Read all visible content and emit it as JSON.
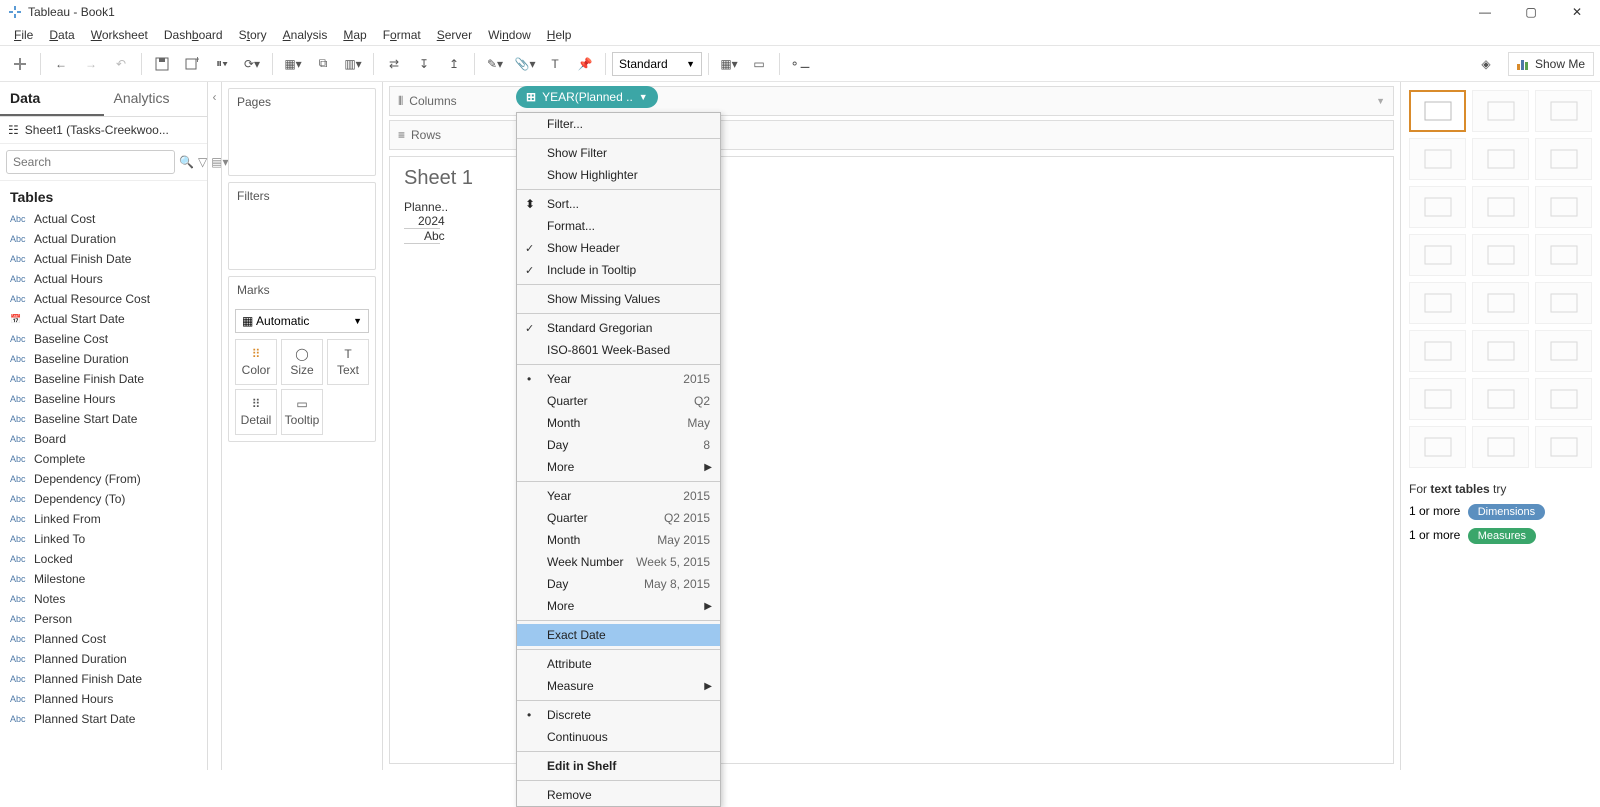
{
  "titlebar": {
    "app": "Tableau",
    "doc": "Book1"
  },
  "menus": [
    "File",
    "Data",
    "Worksheet",
    "Dashboard",
    "Story",
    "Analysis",
    "Map",
    "Format",
    "Server",
    "Window",
    "Help"
  ],
  "fit": "Standard",
  "showme_label": "Show Me",
  "data_pane": {
    "tabs": {
      "data": "Data",
      "analytics": "Analytics"
    },
    "datasource": "Sheet1 (Tasks-Creekwoo...",
    "search_placeholder": "Search",
    "tables_header": "Tables",
    "fields": [
      {
        "type": "Abc",
        "name": "Actual Cost"
      },
      {
        "type": "Abc",
        "name": "Actual Duration"
      },
      {
        "type": "Abc",
        "name": "Actual Finish Date"
      },
      {
        "type": "Abc",
        "name": "Actual Hours"
      },
      {
        "type": "Abc",
        "name": "Actual Resource Cost"
      },
      {
        "type": "date",
        "name": "Actual Start Date"
      },
      {
        "type": "Abc",
        "name": "Baseline Cost"
      },
      {
        "type": "Abc",
        "name": "Baseline Duration"
      },
      {
        "type": "Abc",
        "name": "Baseline Finish Date"
      },
      {
        "type": "Abc",
        "name": "Baseline Hours"
      },
      {
        "type": "Abc",
        "name": "Baseline Start Date"
      },
      {
        "type": "Abc",
        "name": "Board"
      },
      {
        "type": "Abc",
        "name": "Complete"
      },
      {
        "type": "Abc",
        "name": "Dependency (From)"
      },
      {
        "type": "Abc",
        "name": "Dependency (To)"
      },
      {
        "type": "Abc",
        "name": "Linked From"
      },
      {
        "type": "Abc",
        "name": "Linked To"
      },
      {
        "type": "Abc",
        "name": "Locked"
      },
      {
        "type": "Abc",
        "name": "Milestone"
      },
      {
        "type": "Abc",
        "name": "Notes"
      },
      {
        "type": "Abc",
        "name": "Person"
      },
      {
        "type": "Abc",
        "name": "Planned Cost"
      },
      {
        "type": "Abc",
        "name": "Planned Duration"
      },
      {
        "type": "Abc",
        "name": "Planned Finish Date"
      },
      {
        "type": "Abc",
        "name": "Planned Hours"
      },
      {
        "type": "Abc",
        "name": "Planned Start Date"
      }
    ]
  },
  "cards": {
    "pages": "Pages",
    "filters": "Filters",
    "marks": "Marks",
    "marks_type": "Automatic",
    "mark_cells": [
      "Color",
      "Size",
      "Text",
      "Detail",
      "Tooltip"
    ]
  },
  "shelves": {
    "columns": "Columns",
    "rows": "Rows",
    "pill": "YEAR(Planned .."
  },
  "viz": {
    "title": "Sheet 1",
    "field_hdr": "Planne..",
    "year": "2024",
    "mark": "Abc"
  },
  "context_menu": {
    "filter": "Filter...",
    "show_filter": "Show Filter",
    "show_highlighter": "Show Highlighter",
    "sort": "Sort...",
    "format": "Format...",
    "show_header": "Show Header",
    "include_tooltip": "Include in Tooltip",
    "show_missing": "Show Missing Values",
    "std_greg": "Standard Gregorian",
    "iso": "ISO-8601 Week-Based",
    "year": "Year",
    "year_ex": "2015",
    "quarter": "Quarter",
    "quarter_ex": "Q2",
    "month": "Month",
    "month_ex": "May",
    "day": "Day",
    "day_ex": "8",
    "more": "More",
    "year2": "Year",
    "year2_ex": "2015",
    "quarter2": "Quarter",
    "quarter2_ex": "Q2 2015",
    "month2": "Month",
    "month2_ex": "May 2015",
    "week_no": "Week Number",
    "week_no_ex": "Week 5, 2015",
    "day2": "Day",
    "day2_ex": "May 8, 2015",
    "more2": "More",
    "exact_date": "Exact Date",
    "attribute": "Attribute",
    "measure": "Measure",
    "discrete": "Discrete",
    "continuous": "Continuous",
    "edit_shelf": "Edit in Shelf",
    "remove": "Remove"
  },
  "showme": {
    "hint_prefix": "For ",
    "hint_bold": "text tables",
    "hint_suffix": " try",
    "line_dim": "1 or more ",
    "chip_dim": "Dimensions",
    "line_mea": "1 or more ",
    "chip_mea": "Measures"
  }
}
